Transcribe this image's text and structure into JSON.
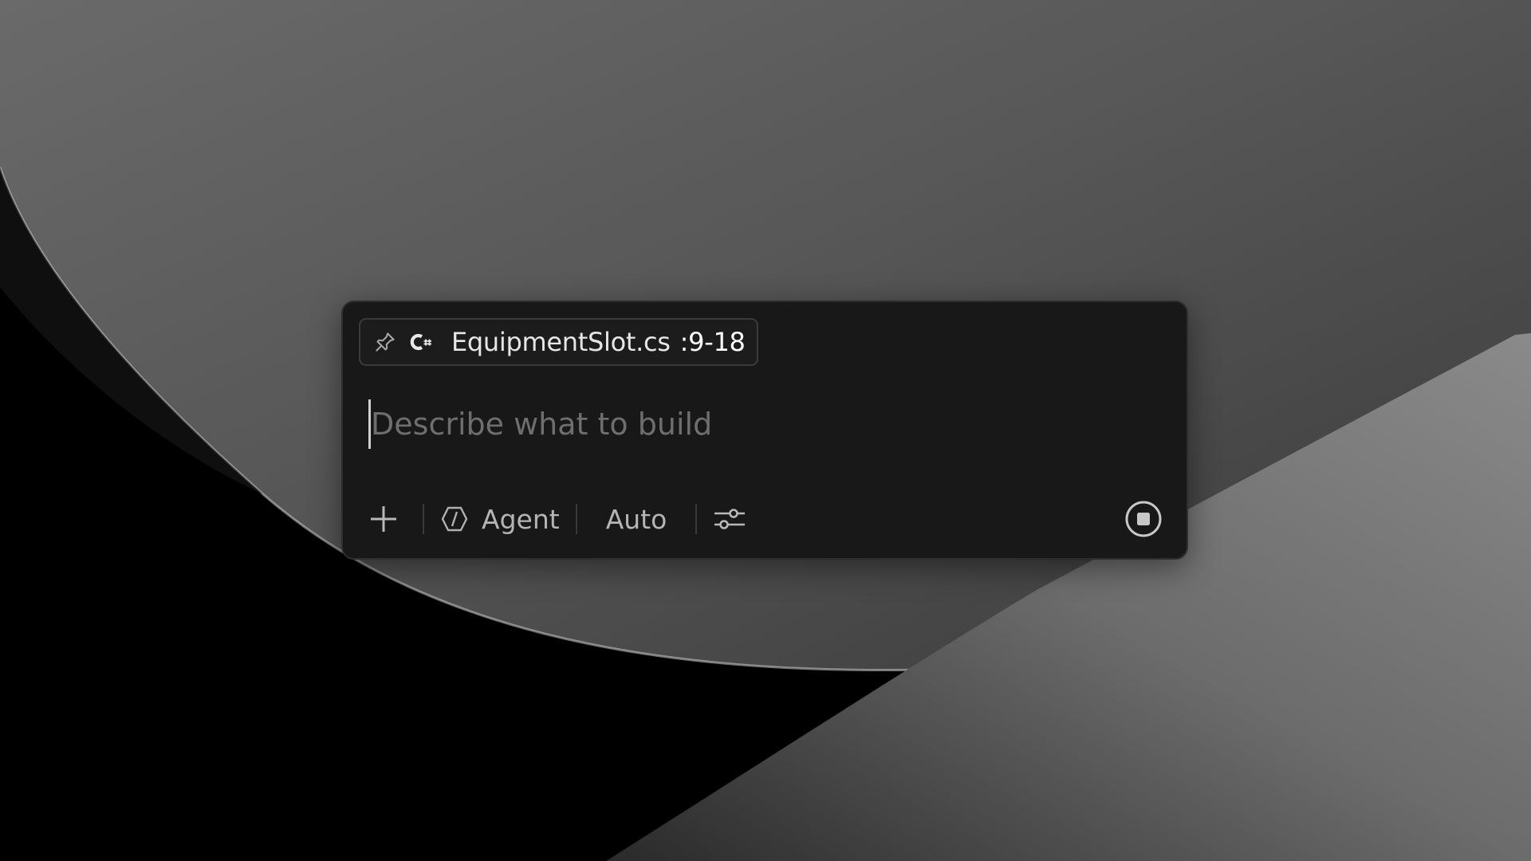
{
  "composer": {
    "context_chip": {
      "pin_icon": "pin-icon",
      "lang_icon": "csharp-icon",
      "file_name": "EquipmentSlot.cs",
      "line_range": ":9-18"
    },
    "prompt": {
      "value": "",
      "placeholder": "Describe what to build"
    },
    "toolbar": {
      "add_icon": "plus-icon",
      "mode_icon": "agent-icon",
      "mode_label": "Agent",
      "model_label": "Auto",
      "settings_icon": "sliders-icon",
      "stop_icon": "stop-icon"
    }
  },
  "theme": {
    "panel_bg": "#181818",
    "panel_border": "#2e2e2e",
    "text_primary": "#e6e6e6",
    "text_muted": "#6e6e6e"
  }
}
